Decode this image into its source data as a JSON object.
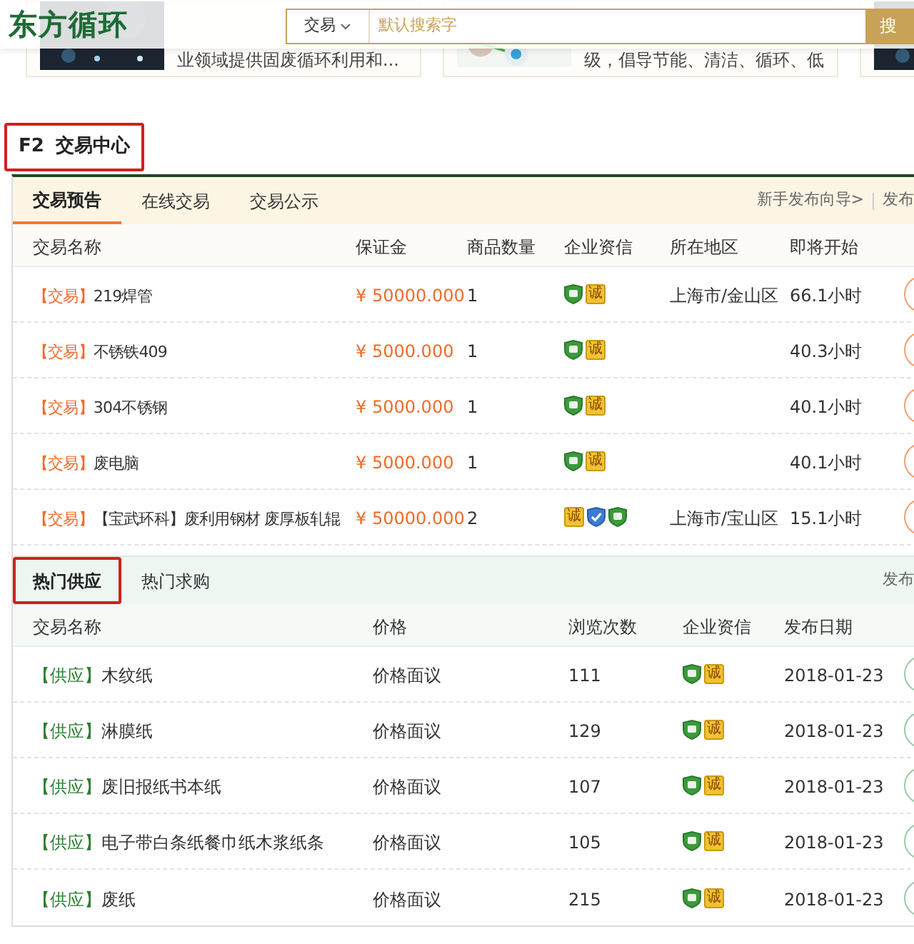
{
  "header": {
    "logo": "东方循环",
    "search": {
      "category": "交易",
      "placeholder": "默认搜索字",
      "button": "搜"
    }
  },
  "promo_cards": [
    {
      "kind": "picture",
      "lines": [
        "业领域提供固废循环利用和..."
      ]
    },
    {
      "kind": "picture",
      "lines": [
        "级，倡导节能、清洁、循环、低"
      ]
    },
    {
      "kind": "picture"
    }
  ],
  "section": {
    "code": "F2",
    "title": "交易中心",
    "highlighted": true
  },
  "trade_panel": {
    "tabs": [
      {
        "label": "交易预告",
        "selected": true,
        "highlighted": false
      },
      {
        "label": "在线交易",
        "selected": false,
        "highlighted": false
      },
      {
        "label": "交易公示",
        "selected": false,
        "highlighted": false
      }
    ],
    "links": [
      "新手发布向导>",
      "发布"
    ],
    "columns": [
      "交易名称",
      "保证金",
      "商品数量",
      "企业资信",
      "所在地区",
      "即将开始"
    ],
    "rows": [
      {
        "tag": "【交易】",
        "name": "219焊管",
        "deposit": "¥ 50000.000",
        "quantity": "1",
        "badges": [
          {
            "kind": "shield"
          },
          {
            "kind": "cheng",
            "label": "诚"
          }
        ],
        "region": "上海市/金山区",
        "start": "66.1小时"
      },
      {
        "tag": "【交易】",
        "name": "不锈铁409",
        "deposit": "¥ 5000.000",
        "quantity": "1",
        "badges": [
          {
            "kind": "shield"
          },
          {
            "kind": "cheng",
            "label": "诚"
          }
        ],
        "start": "40.3小时"
      },
      {
        "tag": "【交易】",
        "name": "304不锈钢",
        "deposit": "¥ 5000.000",
        "quantity": "1",
        "badges": [
          {
            "kind": "shield"
          },
          {
            "kind": "cheng",
            "label": "诚"
          }
        ],
        "start": "40.1小时"
      },
      {
        "tag": "【交易】",
        "name": "废电脑",
        "deposit": "¥ 5000.000",
        "quantity": "1",
        "badges": [
          {
            "kind": "shield"
          },
          {
            "kind": "cheng",
            "label": "诚"
          }
        ],
        "start": "40.1小时"
      },
      {
        "tag": "【交易】",
        "name": "【宝武环科】废利用钢材 废厚板轧辊",
        "deposit": "¥ 50000.000",
        "quantity": "2",
        "badges": [
          {
            "kind": "cheng",
            "label": "诚"
          },
          {
            "kind": "verified"
          },
          {
            "kind": "shield"
          }
        ],
        "region": "上海市/宝山区",
        "start": "15.1小时"
      }
    ]
  },
  "supply_panel": {
    "tabs": [
      {
        "label": "热门供应",
        "selected": true,
        "highlighted": true
      },
      {
        "label": "热门求购",
        "selected": false,
        "highlighted": false
      }
    ],
    "links": [
      "发布"
    ],
    "columns": [
      "交易名称",
      "价格",
      "浏览次数",
      "企业资信",
      "发布日期"
    ],
    "rows": [
      {
        "tag": "【供应】",
        "name": "木纹纸",
        "price": "价格面议",
        "views": "111",
        "badges": [
          {
            "kind": "shield"
          },
          {
            "kind": "cheng",
            "label": "诚"
          }
        ],
        "date": "2018-01-23"
      },
      {
        "tag": "【供应】",
        "name": "淋膜纸",
        "price": "价格面议",
        "views": "129",
        "badges": [
          {
            "kind": "shield"
          },
          {
            "kind": "cheng",
            "label": "诚"
          }
        ],
        "date": "2018-01-23"
      },
      {
        "tag": "【供应】",
        "name": "废旧报纸书本纸",
        "price": "价格面议",
        "views": "107",
        "badges": [
          {
            "kind": "shield"
          },
          {
            "kind": "cheng",
            "label": "诚"
          }
        ],
        "date": "2018-01-23"
      },
      {
        "tag": "【供应】",
        "name": "电子带白条纸餐巾纸木浆纸条",
        "price": "价格面议",
        "views": "105",
        "badges": [
          {
            "kind": "shield"
          },
          {
            "kind": "cheng",
            "label": "诚"
          }
        ],
        "date": "2018-01-23"
      },
      {
        "tag": "【供应】",
        "name": "废纸",
        "price": "价格面议",
        "views": "215",
        "badges": [
          {
            "kind": "shield"
          },
          {
            "kind": "cheng",
            "label": "诚"
          }
        ],
        "date": "2018-01-23"
      }
    ]
  }
}
